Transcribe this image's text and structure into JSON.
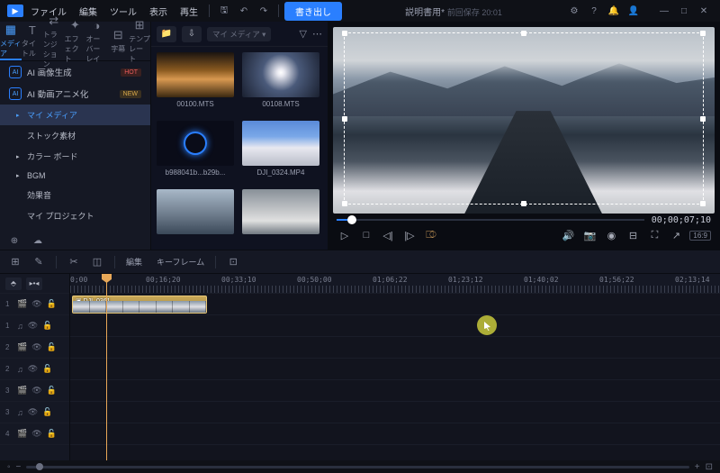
{
  "titlebar": {
    "menus": [
      "ファイル",
      "編集",
      "ツール",
      "表示",
      "再生"
    ],
    "export": "書き出し",
    "title": "説明書用*",
    "autosave": "前回保存 20:01"
  },
  "win": {
    "min": "—",
    "max": "□",
    "close": "✕"
  },
  "tabs": [
    {
      "icon": "▦",
      "label": "メディア"
    },
    {
      "icon": "T",
      "label": "タイトル"
    },
    {
      "icon": "⇄",
      "label": "トランジション"
    },
    {
      "icon": "✦",
      "label": "エフェクト"
    },
    {
      "icon": "◑",
      "label": "オーバーレイ"
    },
    {
      "icon": "⊟",
      "label": "字幕"
    },
    {
      "icon": "⊞",
      "label": "テンプレート"
    }
  ],
  "ai": [
    {
      "label": "AI 画像生成",
      "tag": "HOT",
      "cls": "tag-hot"
    },
    {
      "label": "AI 動画アニメ化",
      "tag": "NEW",
      "cls": "tag-new"
    }
  ],
  "nav": [
    {
      "label": "マイ メディア",
      "chev": "▸",
      "sel": true
    },
    {
      "label": "ストック素材",
      "chev": ""
    },
    {
      "label": "カラー ボード",
      "chev": "▸"
    },
    {
      "label": "BGM",
      "chev": "▸"
    },
    {
      "label": "効果音",
      "chev": ""
    },
    {
      "label": "マイ プロジェクト",
      "chev": ""
    }
  ],
  "media": {
    "dropdown": "マイ メディア",
    "items": [
      {
        "label": "00100.MTS",
        "cls": "t1"
      },
      {
        "label": "00108.MTS",
        "cls": "t2"
      },
      {
        "label": "b988041b...b29b...",
        "cls": "t3"
      },
      {
        "label": "DJI_0324.MP4",
        "cls": "t4"
      },
      {
        "label": "",
        "cls": "t5"
      },
      {
        "label": "",
        "cls": "t6"
      }
    ]
  },
  "preview": {
    "time": "00;00;07;10",
    "aspect": "16:9"
  },
  "tlTabs": {
    "edit": "編集",
    "keyframe": "キーフレーム"
  },
  "ruler": [
    "0;00",
    "00;16;20",
    "00;33;10",
    "00;50;00",
    "01;06;22",
    "01;23;12",
    "01;40;02",
    "01;56;22",
    "02;13;14"
  ],
  "tracks": [
    {
      "num": "1",
      "type": "video"
    },
    {
      "num": "1",
      "type": "audio"
    },
    {
      "num": "2",
      "type": "video"
    },
    {
      "num": "2",
      "type": "audio"
    },
    {
      "num": "3",
      "type": "video"
    },
    {
      "num": "3",
      "type": "audio"
    },
    {
      "num": "4",
      "type": "video"
    }
  ],
  "clip": {
    "label": "DJI_0361"
  }
}
